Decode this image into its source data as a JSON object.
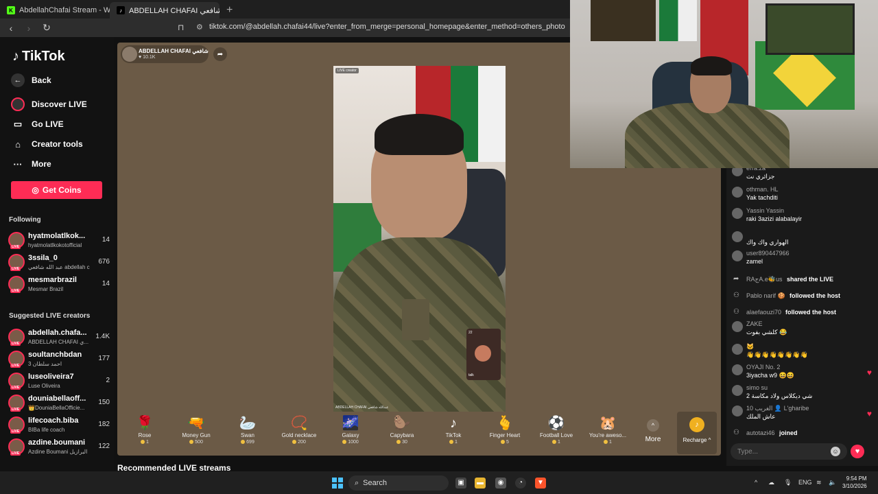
{
  "browser": {
    "tabs": [
      {
        "title": "AbdellahChafai Stream - Watch Live o",
        "active": false
      },
      {
        "title": "ABDELLAH CHAFAI عبدالله شافعي",
        "active": true
      }
    ],
    "url": "tiktok.com/@abdellah.chafai44/live?enter_from_merge=personal_homepage&enter_method=others_photo"
  },
  "sidebar": {
    "logo": "TikTok",
    "nav": [
      {
        "label": "Back"
      },
      {
        "label": "Discover LIVE"
      },
      {
        "label": "Go LIVE"
      },
      {
        "label": "Creator tools"
      },
      {
        "label": "More"
      }
    ],
    "get_coins": "Get Coins",
    "following_title": "Following",
    "following": [
      {
        "name": "hyatmolatlkok...",
        "sub": "hyatmolatlkokotofficial",
        "count": "14"
      },
      {
        "name": "3ssila_0",
        "sub": "عبد الله شافعي abdellah c...",
        "count": "676"
      },
      {
        "name": "mesmarbrazil",
        "sub": "Mesmar Brazil",
        "count": "14"
      }
    ],
    "suggested_title": "Suggested LIVE creators",
    "suggested": [
      {
        "name": "abdellah.chafa...",
        "sub": "ABDELLAH CHAFAI ي...",
        "count": "1.4K"
      },
      {
        "name": "soultanchbdan",
        "sub": "احمد سلطان 3",
        "count": "177"
      },
      {
        "name": "luseoliveira7",
        "sub": "Luse Oliveira",
        "count": "2"
      },
      {
        "name": "douniabellaoff...",
        "sub": "👑DouniaBellaOfficie...",
        "count": "150"
      },
      {
        "name": "lifecoach.biba",
        "sub": "BIBa life coach",
        "count": "182"
      },
      {
        "name": "azdine.boumani",
        "sub": "Azdine Boumani البرازيل",
        "count": "122"
      }
    ]
  },
  "host": {
    "name": "ABDELLAH CHAFAI شافعي",
    "likes": "♥ 10.1K"
  },
  "video": {
    "badge": "LIVE creator",
    "caption": "ABDELLAH CHAFAI عبدالله شافعي",
    "pip_count": "22",
    "pip_label": "talk"
  },
  "gifts": [
    {
      "name": "Rose",
      "price": "1",
      "icon": "🌹"
    },
    {
      "name": "Money Gun",
      "price": "500",
      "icon": "🔫"
    },
    {
      "name": "Swan",
      "price": "699",
      "icon": "🦢"
    },
    {
      "name": "Gold necklace",
      "price": "200",
      "icon": "📿"
    },
    {
      "name": "Galaxy",
      "price": "1000",
      "icon": "🌌"
    },
    {
      "name": "Capybara",
      "price": "30",
      "icon": "🦫"
    },
    {
      "name": "TikTok",
      "price": "1",
      "icon": "♪"
    },
    {
      "name": "Finger Heart",
      "price": "5",
      "icon": "🫰"
    },
    {
      "name": "Football Love",
      "price": "1",
      "icon": "⚽"
    },
    {
      "name": "You're aweso...",
      "price": "1",
      "icon": "🐹"
    }
  ],
  "more_label": "More",
  "recharge_label": "Recharge ^",
  "recommended": "Recommended LIVE streams",
  "chat": [
    {
      "user": "erra.za",
      "text": "جزائري نت",
      "type": "msg"
    },
    {
      "user": "othman. HL",
      "text": "Yak tachditi",
      "type": "msg"
    },
    {
      "user": "Yassin Yassin",
      "text": "raki 3azizi alabalayir",
      "type": "msg"
    },
    {
      "user": "",
      "text": "الهواري واك واك",
      "type": "msg"
    },
    {
      "user": "user890447966",
      "text": "zamel",
      "type": "msg"
    },
    {
      "user": "RAجA.e🐝us",
      "text": "shared the LIVE",
      "type": "sys"
    },
    {
      "user": "Pablo narif 🍪",
      "text": "followed the host",
      "type": "sys"
    },
    {
      "user": "alaefaouzi70",
      "text": "followed the host",
      "type": "sys"
    },
    {
      "user": "ZAKE",
      "text": "كلشي بفوت 😂",
      "type": "msg"
    },
    {
      "user": "🐱",
      "text": "👋👋👋👋👋👋👋👋",
      "type": "msg"
    },
    {
      "user": "OYAJI  No. 2",
      "text": "3iyacha w9 😆😆",
      "type": "msg"
    },
    {
      "user": "simo su",
      "text": "شي ديكلاس ولاد مكاسة 2",
      "type": "msg"
    },
    {
      "user": "10  الغريب 👤 L'gharibe",
      "text": "عاش الملك",
      "type": "msg"
    },
    {
      "user": "autotazi46",
      "text": "joined",
      "type": "sys"
    }
  ],
  "chat_placeholder": "Type...",
  "taskbar": {
    "search": "Search",
    "lang": "ENG",
    "time": "9:54 PM",
    "date": "3/10/2026"
  },
  "colors": {
    "accent": "#fe2c55",
    "stage": "#6b5a46"
  }
}
